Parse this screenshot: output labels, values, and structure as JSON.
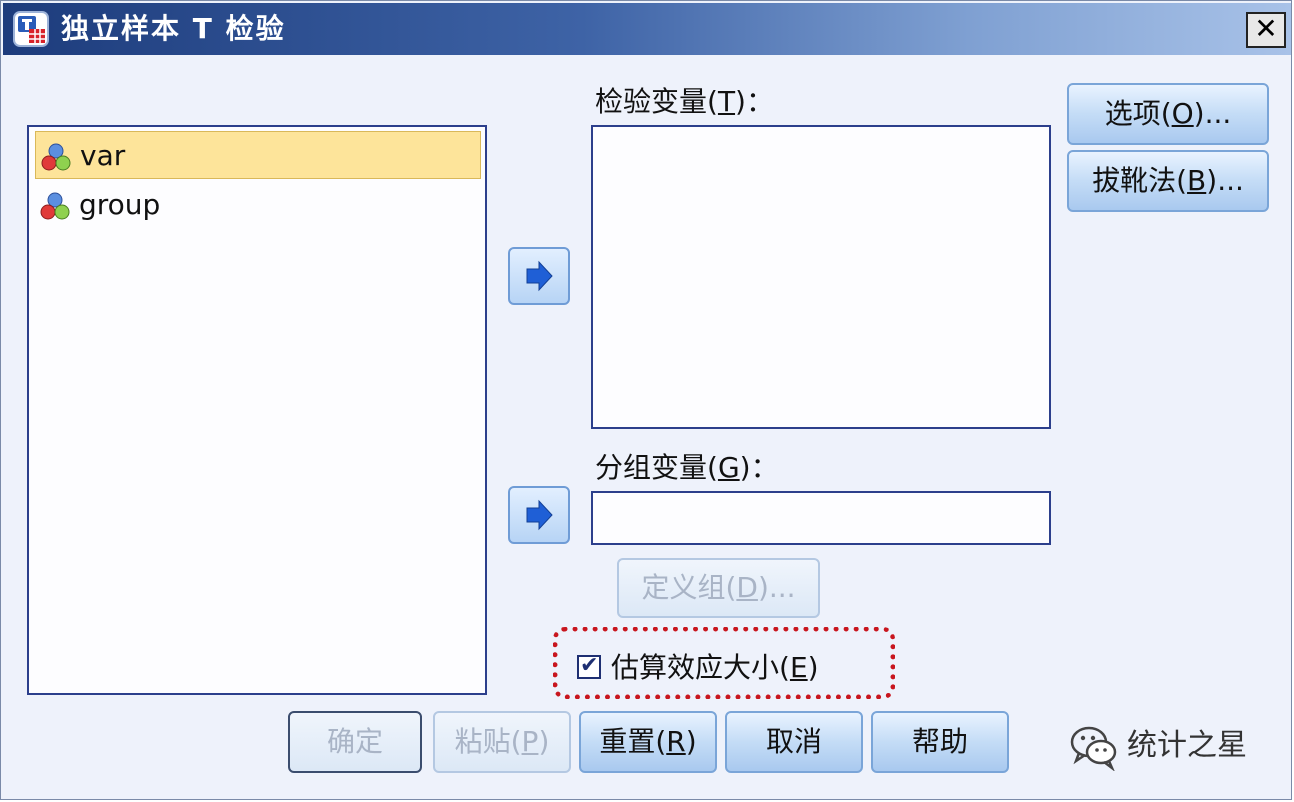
{
  "window": {
    "title": "独立样本 T 检验",
    "close_glyph": "✕"
  },
  "source_list": {
    "items": [
      {
        "name": "var",
        "selected": true
      },
      {
        "name": "group",
        "selected": false
      }
    ]
  },
  "test_variables": {
    "label_prefix": "检验变量(",
    "label_key": "T",
    "label_suffix": ")："
  },
  "grouping_variable": {
    "label_prefix": "分组变量(",
    "label_key": "G",
    "label_suffix": ")："
  },
  "buttons": {
    "options": {
      "prefix": "选项(",
      "key": "O",
      "suffix": ")..."
    },
    "bootstrap": {
      "prefix": "拔靴法(",
      "key": "B",
      "suffix": ")..."
    },
    "define_groups": {
      "prefix": "定义组(",
      "key": "D",
      "suffix": ")..."
    },
    "ok": "确定",
    "paste": {
      "prefix": "粘贴(",
      "key": "P",
      "suffix": ")"
    },
    "reset": {
      "prefix": "重置(",
      "key": "R",
      "suffix": ")"
    },
    "cancel": "取消",
    "help": "帮助"
  },
  "estimate_effect_size": {
    "prefix": "估算效应大小(",
    "key": "E",
    "suffix": ")",
    "checked": true,
    "check_glyph": "✔"
  },
  "watermark": {
    "text": "统计之星",
    "icon": "wechat-icon"
  },
  "icons": {
    "app": "spss-table-icon",
    "variable": "scale-variable-icon",
    "move": "right-arrow-icon"
  },
  "colors": {
    "title_gradient_start": "#1d3c7c",
    "title_gradient_end": "#a8c2e8",
    "selection": "#fde49a",
    "highlight_border": "#c8161e",
    "dialog_bg": "#eef2fb"
  }
}
